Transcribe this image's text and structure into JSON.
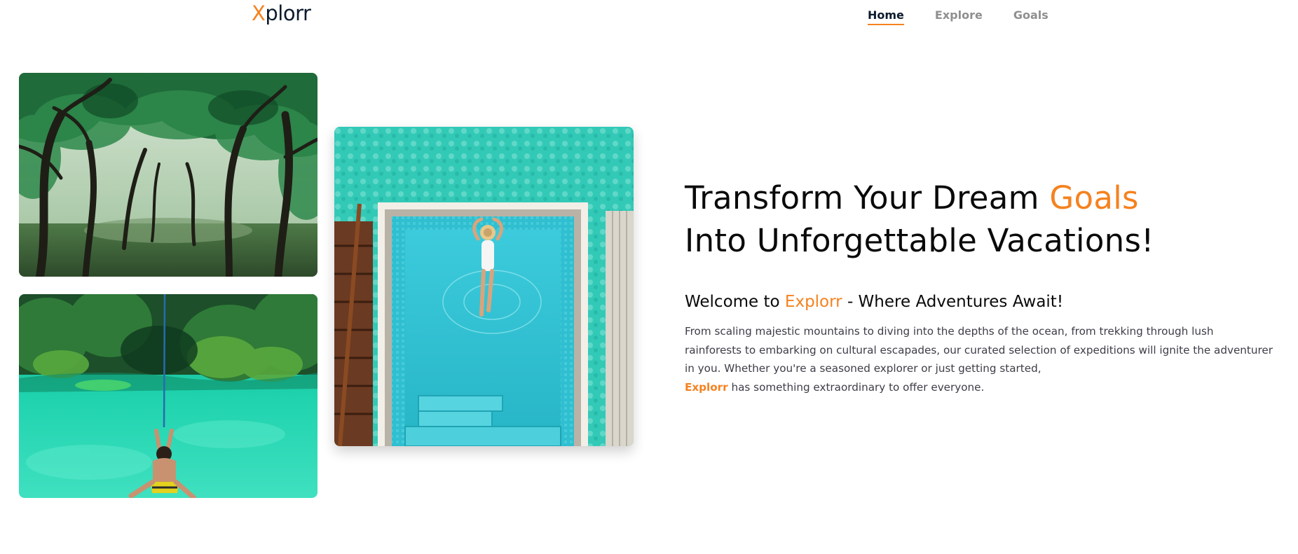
{
  "brand": {
    "logo_first_letter": "X",
    "logo_rest": "plorr",
    "accent_color": "#f5821f",
    "dark_color": "#0d1b2e"
  },
  "nav": {
    "items": [
      {
        "label": "Home",
        "active": true
      },
      {
        "label": "Explore",
        "active": false
      },
      {
        "label": "Goals",
        "active": false
      }
    ]
  },
  "gallery": {
    "images": [
      {
        "name": "forest-trees-photo"
      },
      {
        "name": "lagoon-rope-swing-photo"
      },
      {
        "name": "woman-in-pool-aerial-photo"
      }
    ]
  },
  "hero": {
    "title_part1": "Transform Your Dream ",
    "title_accent": "Goals",
    "title_part2": "Into Unforgettable Vacations!",
    "welcome_prefix": "Welcome to ",
    "welcome_brand": "Explorr",
    "welcome_suffix": " - Where Adventures Await!",
    "description": "From scaling majestic mountains to diving into the depths of the ocean, from trekking through lush rainforests to embarking on cultural escapades, our curated selection of expeditions will ignite the adventurer in you. Whether you're a seasoned explorer or just getting started,",
    "description_brand": "Explorr",
    "description_end": " has something extraordinary to offer everyone."
  }
}
